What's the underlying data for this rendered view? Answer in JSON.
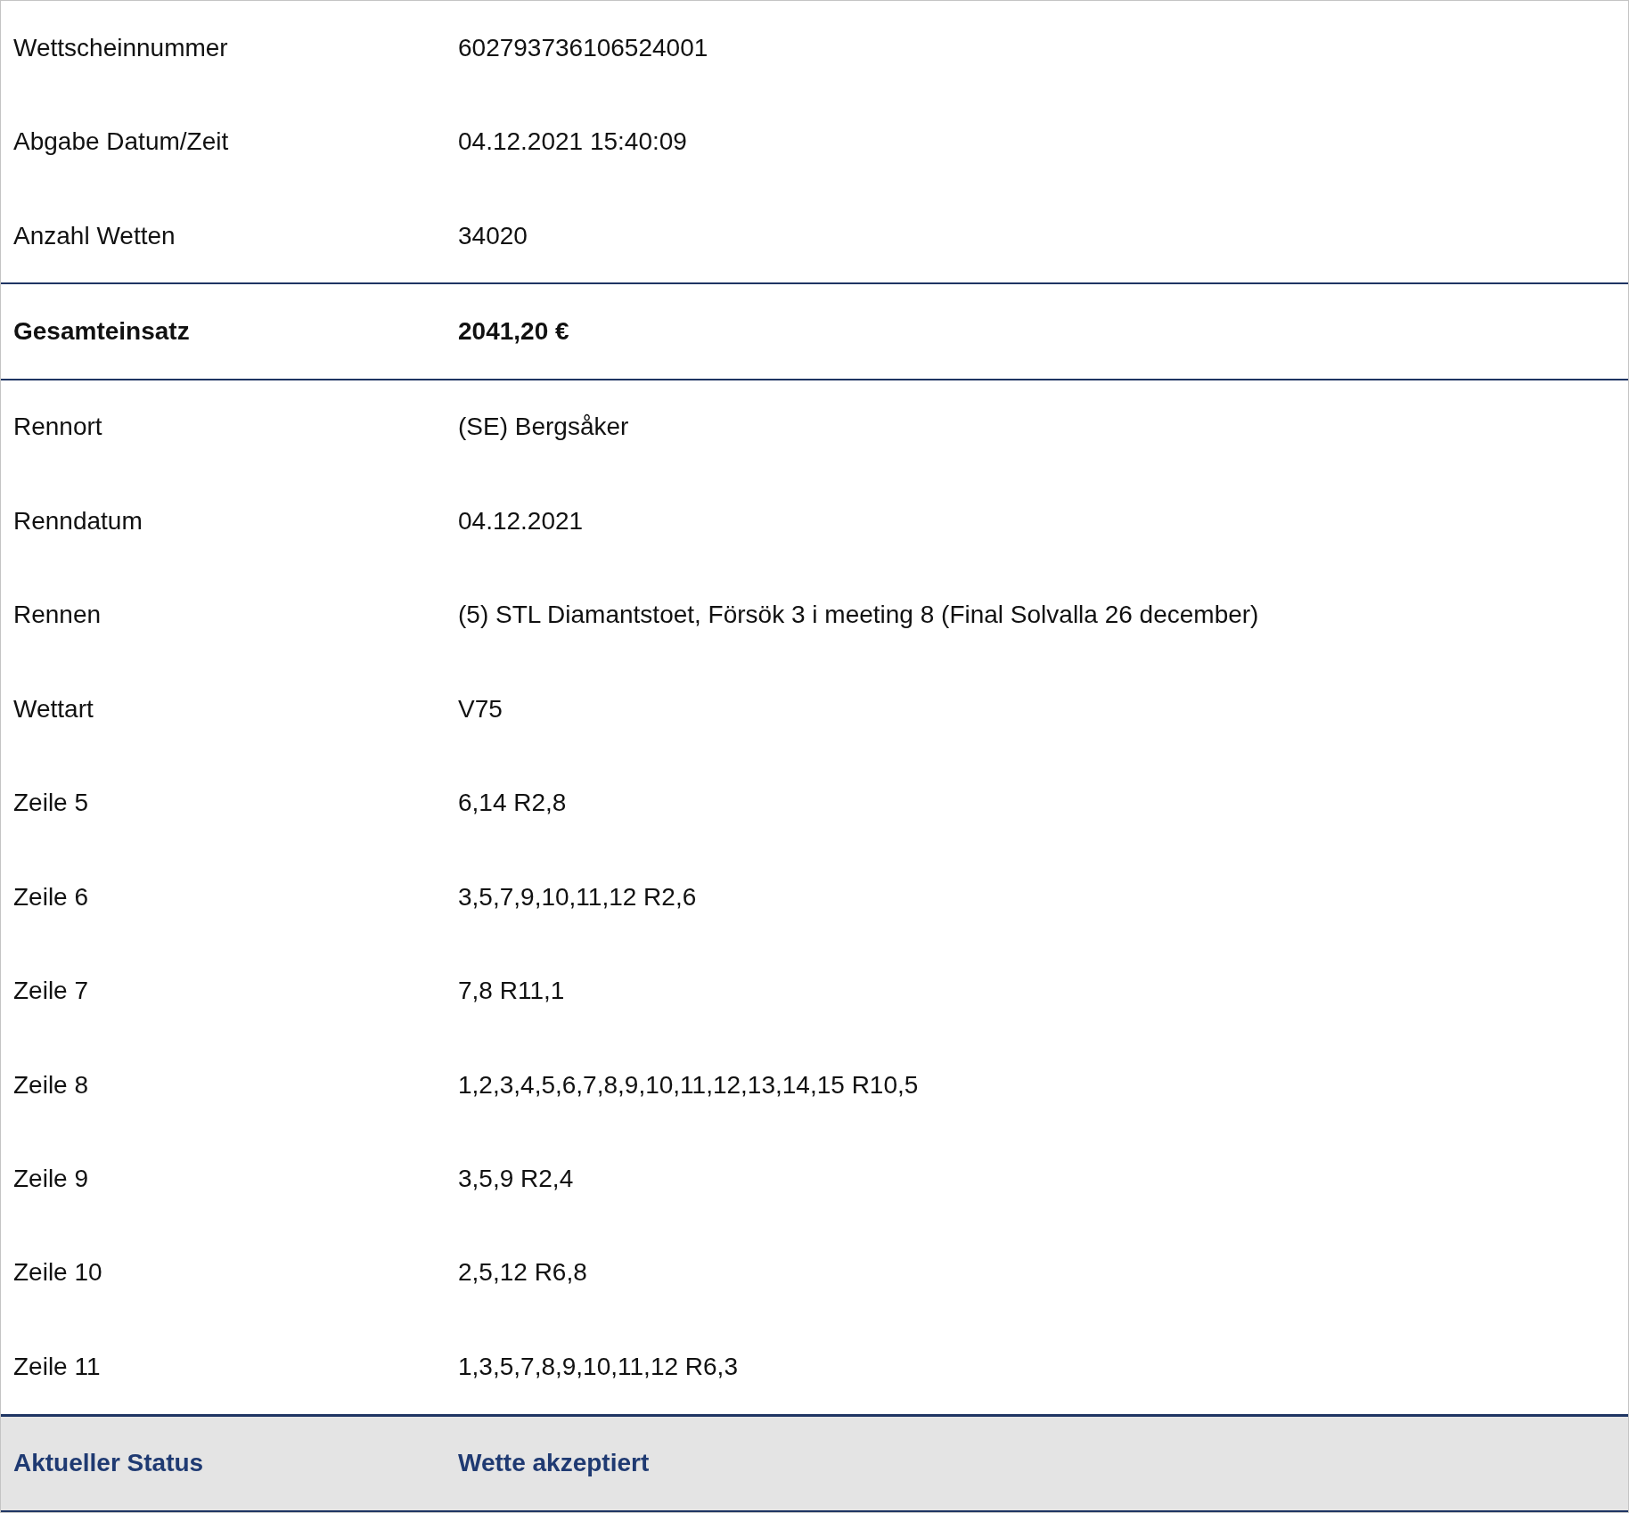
{
  "rows": [
    {
      "kind": "normal",
      "label": "Wettscheinnummer",
      "value": "602793736106524001"
    },
    {
      "kind": "normal",
      "label": "Abgabe Datum/Zeit",
      "value": "04.12.2021 15:40:09"
    },
    {
      "kind": "normal",
      "label": "Anzahl Wetten",
      "value": "34020"
    },
    {
      "kind": "total",
      "label": "Gesamteinsatz",
      "value": "2041,20 €"
    },
    {
      "kind": "normal",
      "label": "Rennort",
      "value": "(SE) Bergsåker"
    },
    {
      "kind": "normal",
      "label": "Renndatum",
      "value": "04.12.2021"
    },
    {
      "kind": "normal",
      "label": "Rennen",
      "value": "(5) STL Diamantstoet, Försök 3 i meeting 8 (Final Solvalla 26 december)"
    },
    {
      "kind": "normal",
      "label": "Wettart",
      "value": "V75"
    },
    {
      "kind": "normal",
      "label": "Zeile 5",
      "value": "6,14 R2,8"
    },
    {
      "kind": "normal",
      "label": "Zeile 6",
      "value": "3,5,7,9,10,11,12 R2,6"
    },
    {
      "kind": "normal",
      "label": "Zeile 7",
      "value": "7,8 R11,1"
    },
    {
      "kind": "normal",
      "label": "Zeile 8",
      "value": "1,2,3,4,5,6,7,8,9,10,11,12,13,14,15 R10,5"
    },
    {
      "kind": "normal",
      "label": "Zeile 9",
      "value": "3,5,9 R2,4"
    },
    {
      "kind": "normal",
      "label": "Zeile 10",
      "value": "2,5,12 R6,8"
    },
    {
      "kind": "normal",
      "label": "Zeile 11",
      "value": "1,3,5,7,8,9,10,11,12 R6,3"
    },
    {
      "kind": "status",
      "label": "Aktueller Status",
      "value": "Wette akzeptiert"
    }
  ]
}
